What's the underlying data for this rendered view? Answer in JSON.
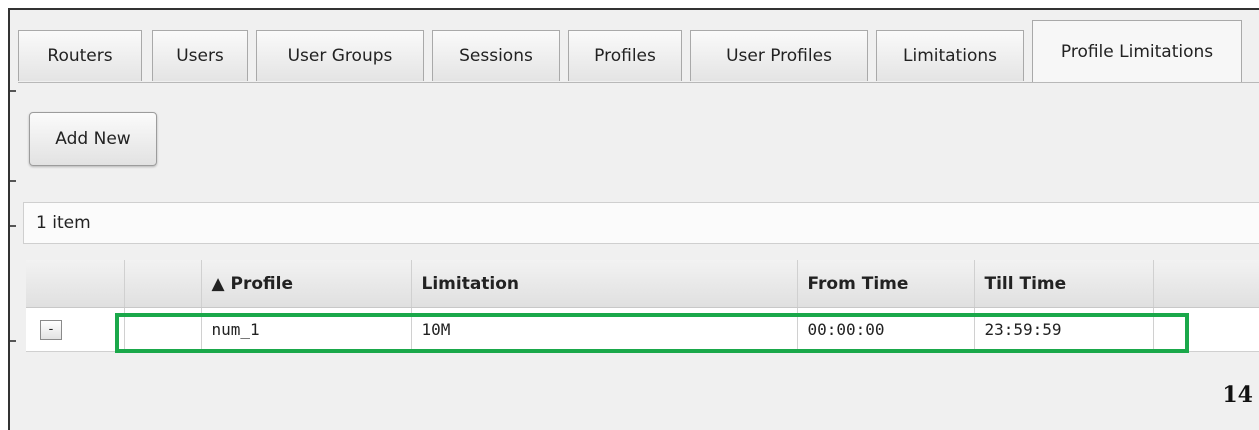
{
  "tabs": [
    {
      "label": "Routers",
      "active": false
    },
    {
      "label": "Users",
      "active": false
    },
    {
      "label": "User Groups",
      "active": false
    },
    {
      "label": "Sessions",
      "active": false
    },
    {
      "label": "Profiles",
      "active": false
    },
    {
      "label": "User Profiles",
      "active": false
    },
    {
      "label": "Limitations",
      "active": false
    },
    {
      "label": "Profile Limitations",
      "active": true
    }
  ],
  "toolbar": {
    "add_label": "Add New"
  },
  "list": {
    "item_count": "1 item"
  },
  "table": {
    "columns": [
      "",
      "",
      "▲ Profile",
      "Limitation",
      "From Time",
      "Till Time",
      ""
    ],
    "rows": [
      {
        "control": "-",
        "profile": "num_1",
        "limitation": "10M",
        "from_time": "00:00:00",
        "till_time": "23:59:59"
      }
    ]
  },
  "page_number": "14",
  "colors": {
    "highlight": "#1aa84a"
  }
}
